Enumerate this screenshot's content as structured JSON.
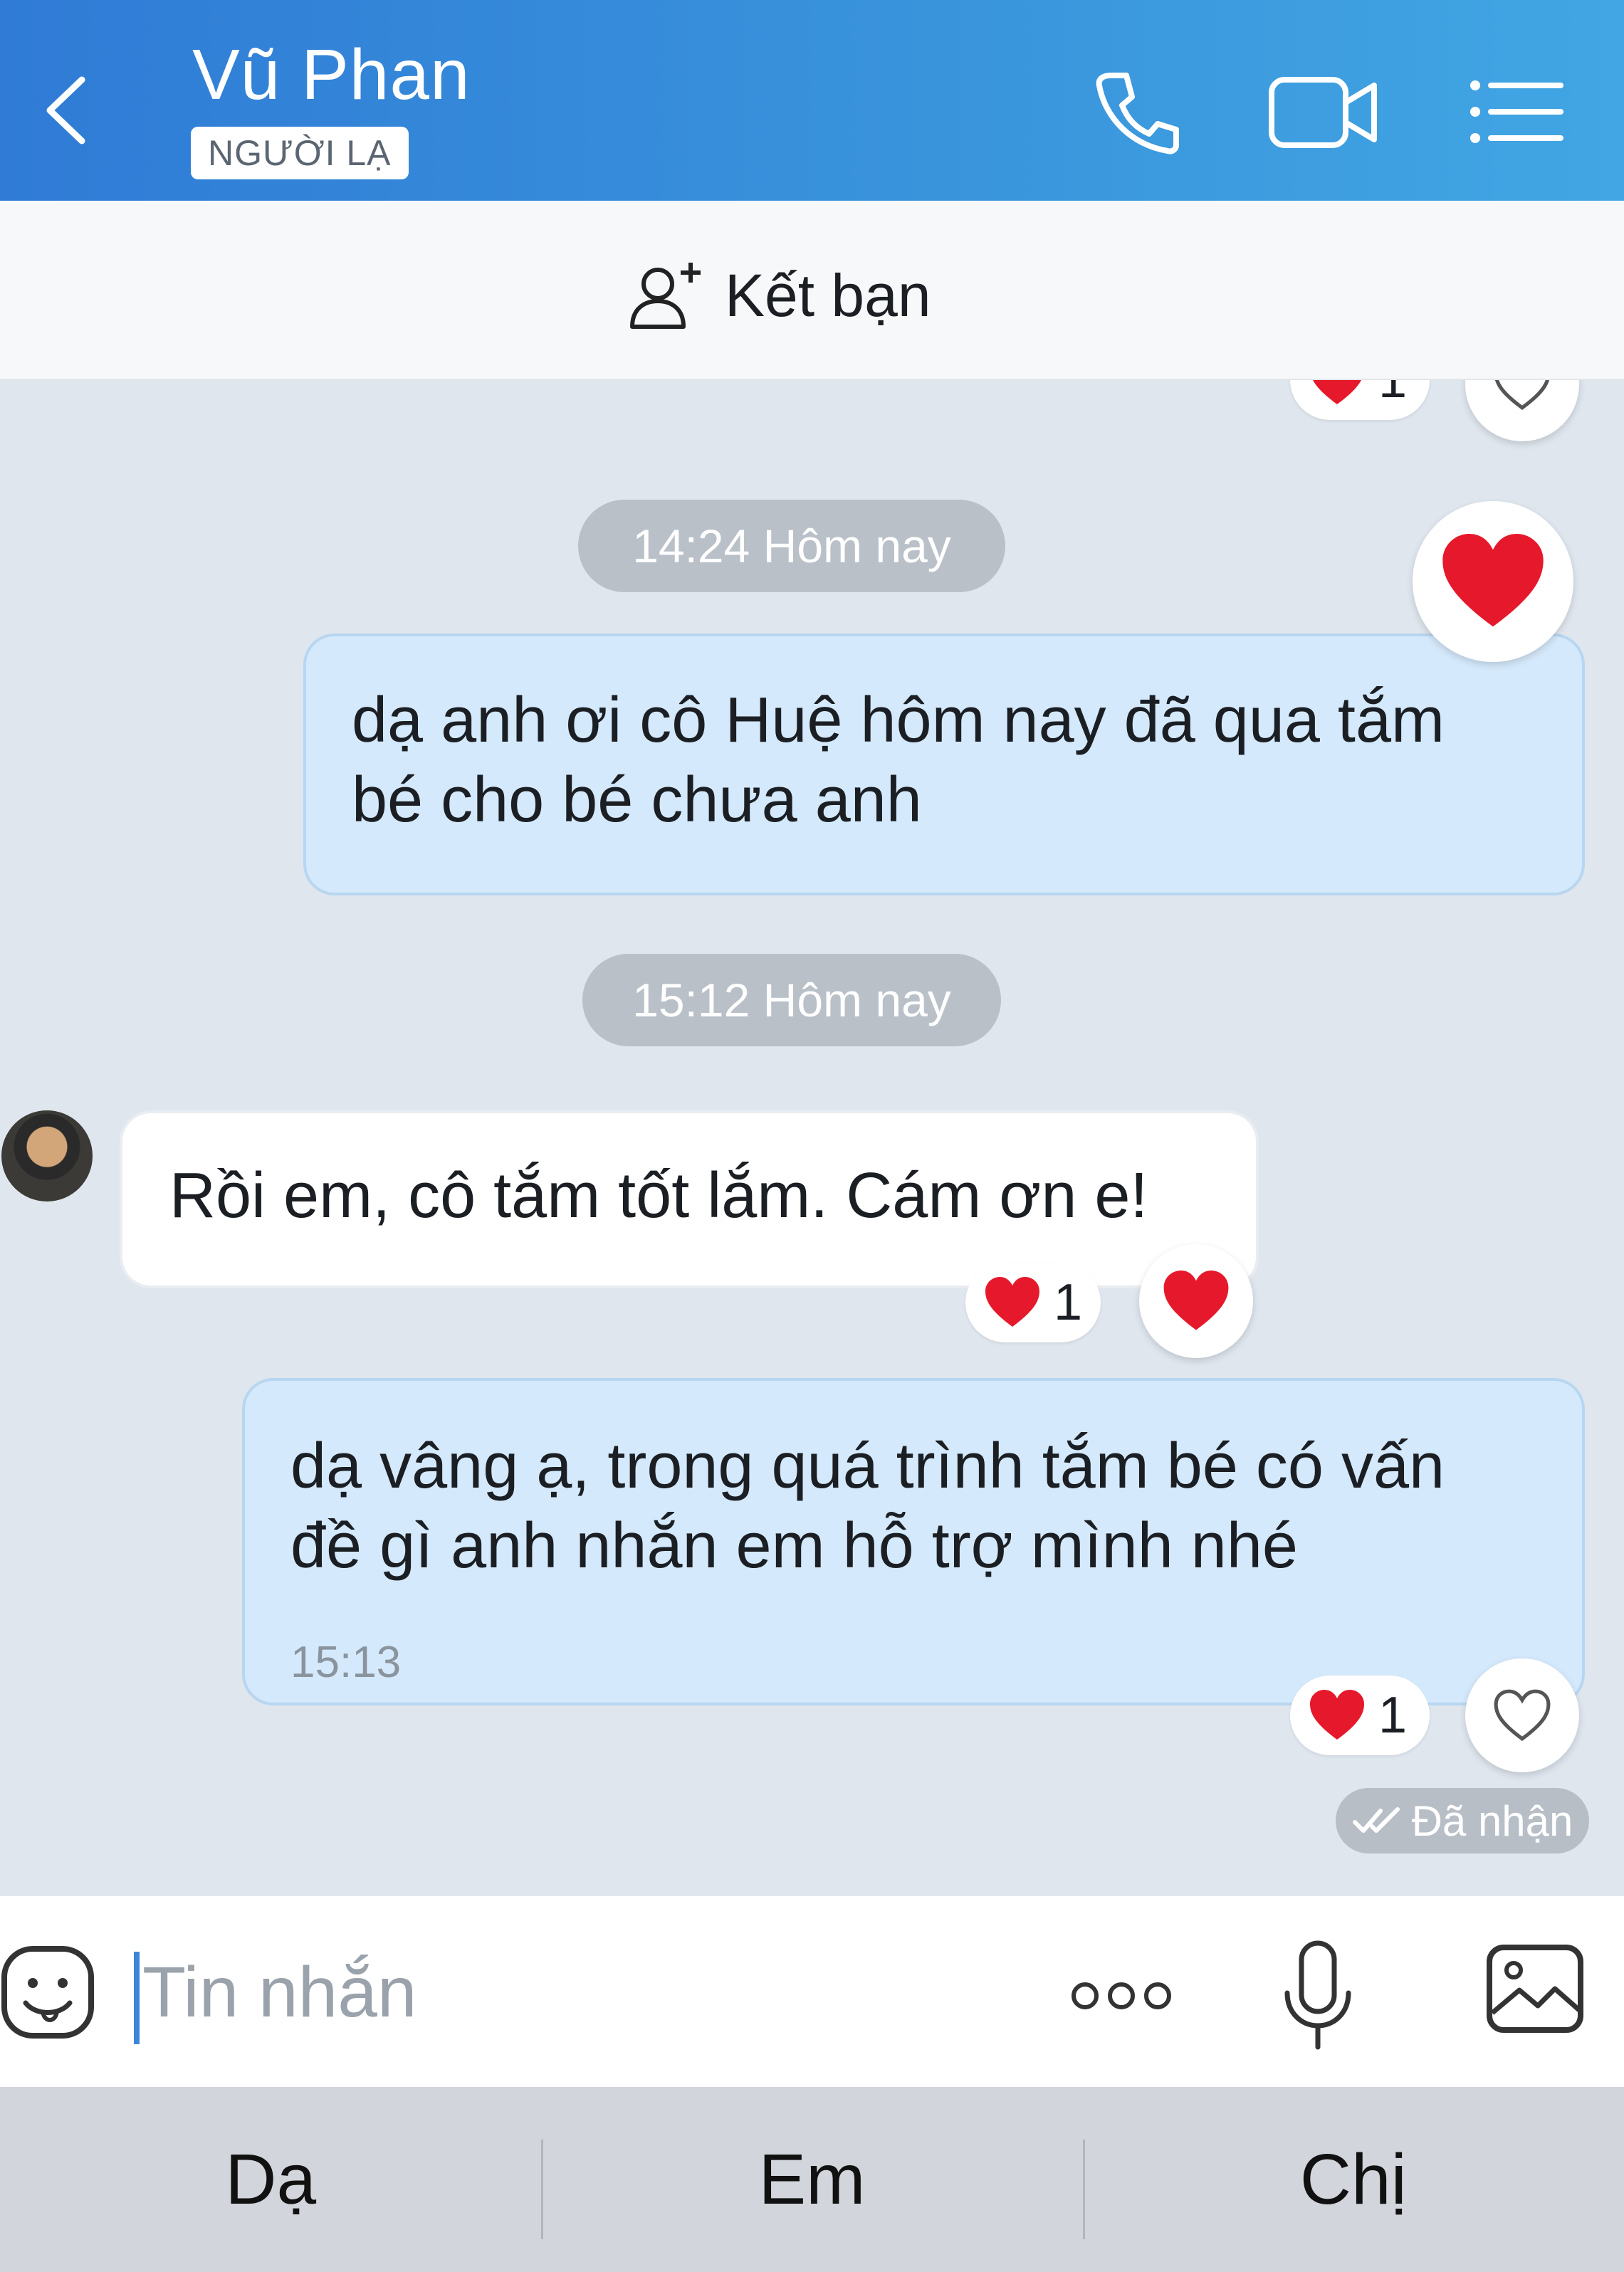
{
  "header": {
    "title": "Vũ Phan",
    "badge": "NGƯỜI LẠ",
    "back_icon": "chevron-left-icon",
    "call_icon": "phone-icon",
    "video_icon": "video-camera-icon",
    "menu_icon": "list-menu-icon"
  },
  "friend_bar": {
    "label": "Kết bạn",
    "icon": "add-friend-icon"
  },
  "messages": [
    {
      "type": "time",
      "text": "14:24 Hôm nay"
    },
    {
      "type": "sent",
      "text": "dạ anh ơi cô Huệ hôm nay đã qua tắm\nbé cho bé chưa anh",
      "reaction": "heart"
    },
    {
      "type": "time",
      "text": "15:12 Hôm nay"
    },
    {
      "type": "received",
      "text": "Rồi em, cô tắm tốt lắm. Cám ơn e!",
      "reaction_count": "1"
    },
    {
      "type": "sent",
      "text": "dạ vâng ạ, trong quá trình tắm bé có vấn\nđề gì anh nhắn em hỗ trợ mình nhé",
      "time": "15:13",
      "reaction_count": "1"
    }
  ],
  "top_partial_reaction_count": "1",
  "status": "Đã nhận",
  "input": {
    "placeholder": "Tin nhắn",
    "value": ""
  },
  "quick_replies": [
    "Dạ",
    "Em",
    "Chị"
  ],
  "colors": {
    "header_start": "#2f7bd6",
    "header_end": "#41a6e3",
    "sent_bubble": "#d4e9fb",
    "received_bubble": "#ffffff",
    "heart": "#e5192b",
    "chat_bg": "#dfe6ee"
  }
}
